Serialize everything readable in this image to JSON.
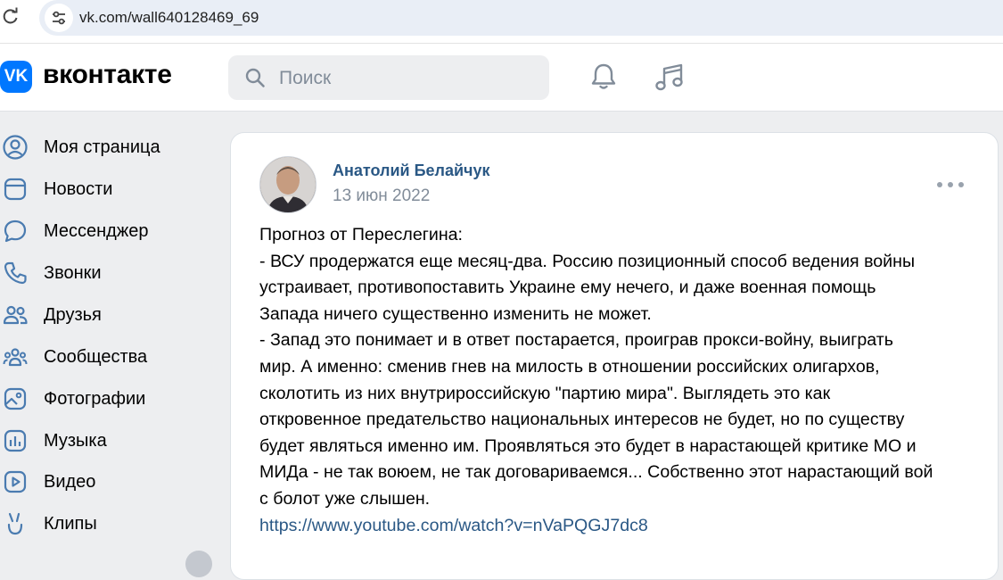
{
  "browser": {
    "url": "vk.com/wall640128469_69"
  },
  "header": {
    "logo_text": "VK",
    "wordmark": "вконтакте",
    "search_placeholder": "Поиск"
  },
  "sidebar": {
    "items": [
      {
        "label": "Моя страница",
        "icon": "user-circle-icon"
      },
      {
        "label": "Новости",
        "icon": "news-icon"
      },
      {
        "label": "Мессенджер",
        "icon": "message-icon"
      },
      {
        "label": "Звонки",
        "icon": "phone-icon"
      },
      {
        "label": "Друзья",
        "icon": "friends-icon"
      },
      {
        "label": "Сообщества",
        "icon": "communities-icon"
      },
      {
        "label": "Фотографии",
        "icon": "photo-icon"
      },
      {
        "label": "Музыка",
        "icon": "music-bars-icon"
      },
      {
        "label": "Видео",
        "icon": "video-icon"
      },
      {
        "label": "Клипы",
        "icon": "clips-icon"
      }
    ]
  },
  "post": {
    "author": "Анатолий Белайчук",
    "date": "13 июн 2022",
    "lines": [
      "Прогноз от Переслегина:",
      "- ВСУ продержатся еще месяц-два. Россию позиционный способ ведения войны",
      "устраивает, противопоставить Украине ему нечего, и даже военная помощь",
      "Запада ничего существенно изменить не может.",
      "- Запад это понимает и в ответ постарается, проиграв прокси-войну, выиграть",
      "мир. А именно: сменив гнев на милость в отношении российских олигархов,",
      "сколотить из них внутрироссийскую \"партию мира\". Выглядеть это как",
      "откровенное предательство национальных интересов не будет, но по существу",
      "будет являться именно им. Проявляться это будет в нарастающей критике МО и",
      "МИДа - не так воюем, не так договариваемся... Собственно этот нарастающий вой",
      "с болот уже слышен."
    ],
    "link": "https://www.youtube.com/watch?v=nVaPQGJ7dc8"
  },
  "colors": {
    "accent": "#0077ff",
    "link": "#2a5885",
    "muted": "#818c99",
    "page_bg": "#edeef0"
  }
}
